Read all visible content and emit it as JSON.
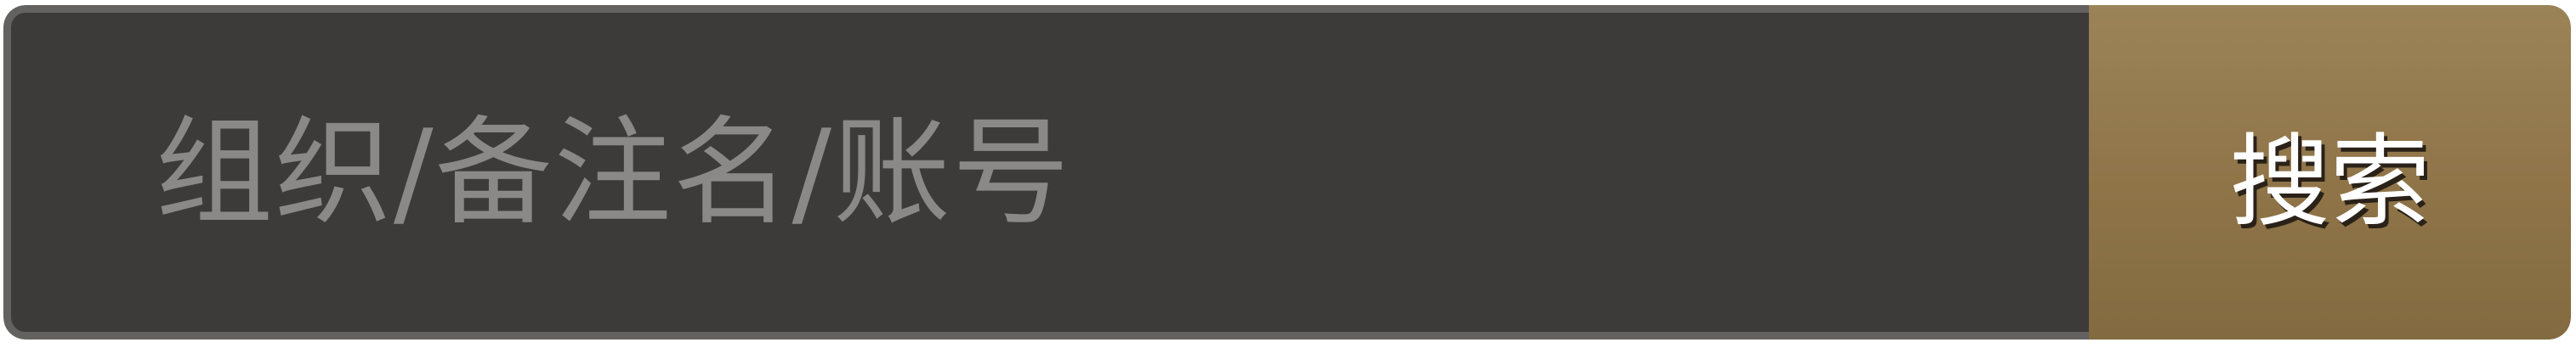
{
  "search": {
    "placeholder": "组织/备注名/账号",
    "value": "",
    "button_label": "搜索"
  },
  "colors": {
    "input_background": "#3c3b39",
    "input_border": "#636260",
    "placeholder_text": "#8a8987",
    "button_gradient_top": "#9b8358",
    "button_gradient_bottom": "#836a40",
    "button_text": "#ffffff"
  }
}
